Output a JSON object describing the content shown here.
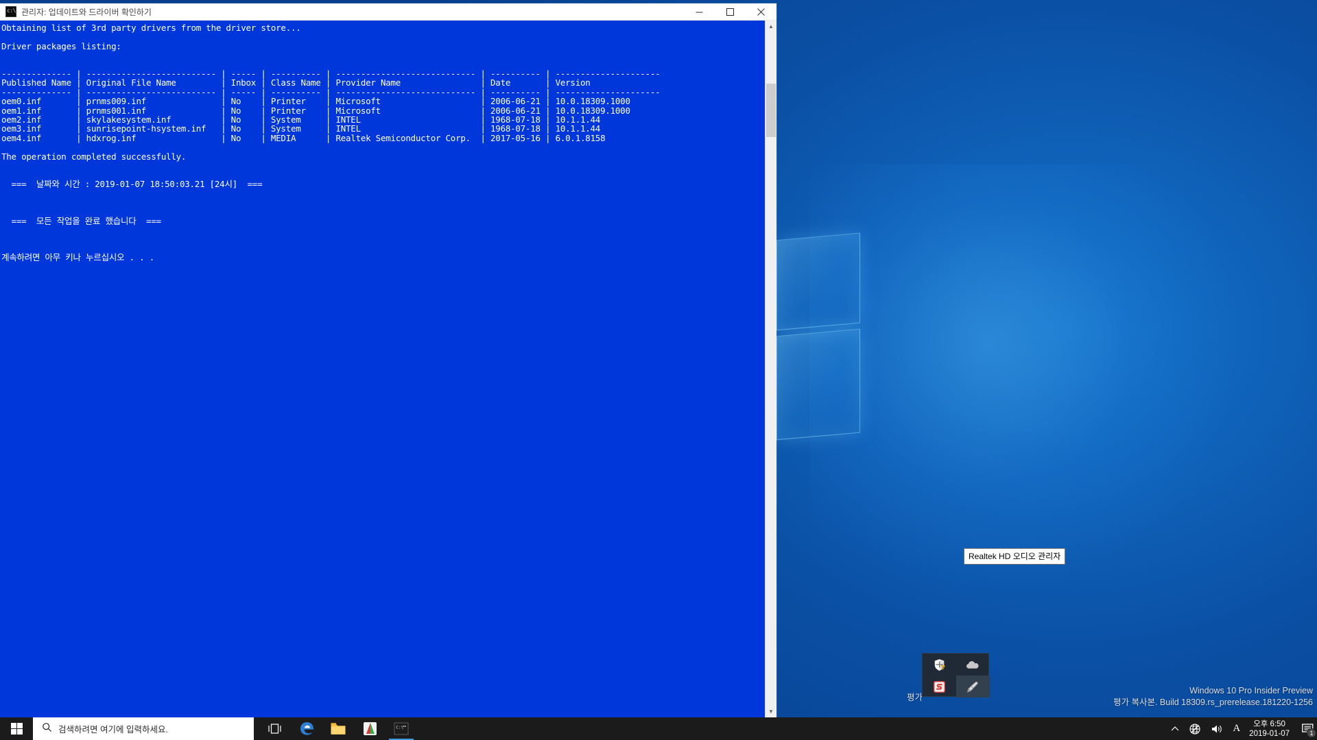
{
  "window": {
    "title": "관리자: 업데이트와 드라이버 확인하기",
    "icon": "cmd-icon",
    "minimize_label": "─",
    "maximize_label": "□",
    "close_label": "✕"
  },
  "console": {
    "line1": "Obtaining list of 3rd party drivers from the driver store...",
    "line2": "Driver packages listing:",
    "rule_top": "-------------- | -------------------------- | ----- | ---------- | ---------------------------- | ---------- | ---------------------",
    "headers": [
      "Published Name",
      "Original File Name",
      "Inbox",
      "Class Name",
      "Provider Name",
      "Date",
      "Version"
    ],
    "rule_mid": "-------------- | -------------------------- | ----- | ---------- | ---------------------------- | ---------- | ---------------------",
    "rows": [
      {
        "published": "oem0.inf",
        "file": "prnms009.inf",
        "inbox": "No",
        "class": "Printer",
        "provider": "Microsoft",
        "date": "2006-06-21",
        "version": "10.0.18309.1000"
      },
      {
        "published": "oem1.inf",
        "file": "prnms001.inf",
        "inbox": "No",
        "class": "Printer",
        "provider": "Microsoft",
        "date": "2006-06-21",
        "version": "10.0.18309.1000"
      },
      {
        "published": "oem2.inf",
        "file": "skylakesystem.inf",
        "inbox": "No",
        "class": "System",
        "provider": "INTEL",
        "date": "1968-07-18",
        "version": "10.1.1.44"
      },
      {
        "published": "oem3.inf",
        "file": "sunrisepoint-hsystem.inf",
        "inbox": "No",
        "class": "System",
        "provider": "INTEL",
        "date": "1968-07-18",
        "version": "10.1.1.44"
      },
      {
        "published": "oem4.inf",
        "file": "hdxrog.inf",
        "inbox": "No",
        "class": "MEDIA",
        "provider": "Realtek Semiconductor Corp.",
        "date": "2017-05-16",
        "version": "6.0.1.8158"
      }
    ],
    "success_line": "The operation completed successfully.",
    "datetime_line": "  ===  날짜와 시간 : 2019-01-07 18:50:03.21 [24시]  ===",
    "done_line": "  ===  모든 작업을 완료 했습니다  ===",
    "press_key_line": "계속하려면 아무 키나 누르십시오 . . ."
  },
  "scrollbar": {
    "up_arrow": "▲",
    "down_arrow": "▼"
  },
  "taskbar": {
    "start_label": "start-button",
    "search_placeholder": "검색하려면 여기에 입력하세요.",
    "apps": [
      {
        "name": "task-view",
        "label": "Task View"
      },
      {
        "name": "edge",
        "label": "Microsoft Edge"
      },
      {
        "name": "file-explorer",
        "label": "파일 탐색기"
      },
      {
        "name": "media-player",
        "label": "Media Player"
      },
      {
        "name": "command-prompt",
        "label": "명령 프롬프트"
      }
    ],
    "tray": {
      "show_hidden_label": "∧",
      "network_label": "network-icon",
      "volume_label": "volume-icon",
      "ime_label": "A",
      "time": "오후 6:50",
      "date": "2019-01-07",
      "notification_count": "1"
    }
  },
  "tray_flyout": {
    "items": [
      {
        "name": "security-shield-icon",
        "label": "Windows 보안"
      },
      {
        "name": "onedrive-cloud-icon",
        "label": "OneDrive"
      },
      {
        "name": "sandboxie-icon",
        "label": "Sandboxie"
      },
      {
        "name": "realtek-audio-icon",
        "label": "Realtek HD 오디오 관리자"
      }
    ]
  },
  "tooltip": {
    "text": "Realtek HD 오디오 관리자"
  },
  "watermark": {
    "eval": "평가",
    "line1": "Windows 10 Pro Insider Preview",
    "line2": "평가 복사본. Build 18309.rs_prerelease.181220-1256"
  }
}
